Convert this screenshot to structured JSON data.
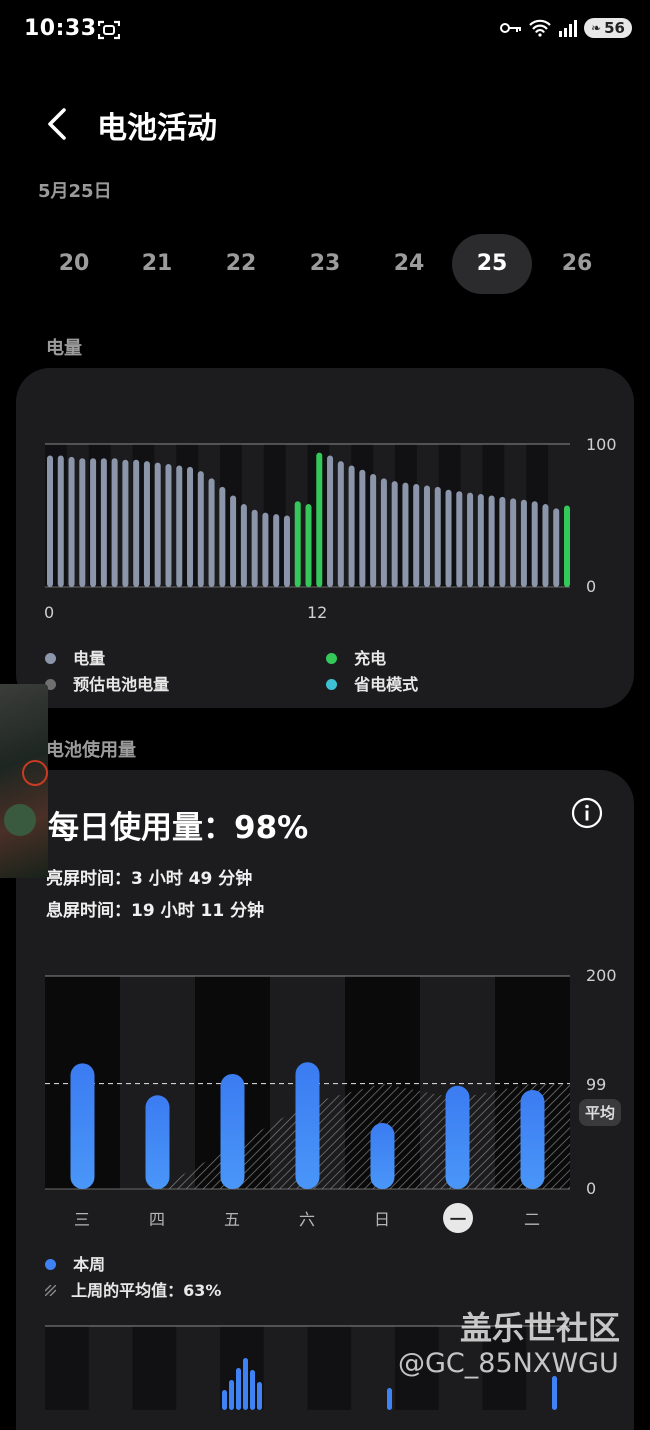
{
  "status_bar": {
    "time": "10:33",
    "battery": "56"
  },
  "header": {
    "title": "电池活动",
    "date": "5月25日"
  },
  "days": [
    "20",
    "21",
    "22",
    "23",
    "24",
    "25",
    "26"
  ],
  "battery_level": {
    "section_label": "电量",
    "y_max_label": "100",
    "y_min_label": "0",
    "x_labels": [
      "0",
      "12"
    ],
    "legend": [
      "电量",
      "充电",
      "预估电池电量",
      "省电模式"
    ],
    "colors": {
      "level": "#8c96aa",
      "charging": "#34c759",
      "estimate": "#707070",
      "saver": "#3ec0d4"
    }
  },
  "usage": {
    "section_label": "电池使用量",
    "daily_usage": "每日使用量：98%",
    "screen_on": "亮屏时间：3 小时 49 分钟",
    "screen_off": "息屏时间：19 小时 11 分钟",
    "y_max_label": "200",
    "avg_label": "99",
    "y_min_label": "0",
    "avg_badge": "平均",
    "weekdays": [
      "三",
      "四",
      "五",
      "六",
      "日",
      "一",
      "二"
    ],
    "legend_this_week": "本周",
    "legend_last_week": "上周的平均值：63%",
    "colors": {
      "bar": "#3f82f4"
    }
  },
  "watermark": {
    "site": "盖乐世社区",
    "user": "@GC_85NXWGU"
  },
  "chart_data": [
    {
      "type": "bar",
      "title": "电量",
      "x": [
        "0",
        "",
        "",
        "",
        "",
        "",
        "",
        "",
        "",
        "",
        "",
        "",
        "12",
        "",
        "",
        "",
        "",
        "",
        "",
        "",
        "",
        "",
        "",
        ""
      ],
      "series": [
        {
          "name": "电量",
          "values": [
            92,
            92,
            91,
            90,
            90,
            90,
            90,
            89,
            89,
            88,
            87,
            86,
            85,
            84,
            81,
            76,
            70,
            64,
            58,
            54,
            52,
            51,
            50,
            60,
            58,
            94,
            92,
            88,
            85,
            82,
            79,
            76,
            74,
            73,
            72,
            71,
            70,
            68,
            67,
            66,
            65,
            64,
            63,
            62,
            61,
            60,
            58,
            55,
            57
          ]
        }
      ],
      "ylim": [
        0,
        100
      ],
      "xlabel": "",
      "ylabel": ""
    },
    {
      "type": "bar",
      "title": "每日使用量：98%",
      "categories": [
        "三",
        "四",
        "五",
        "六",
        "日",
        "一",
        "二"
      ],
      "series": [
        {
          "name": "本周",
          "values": [
            118,
            88,
            108,
            119,
            62,
            97,
            93
          ]
        },
        {
          "name": "上周的平均值：63%",
          "values": [
            0,
            0,
            40,
            80,
            99,
            85,
            99
          ]
        }
      ],
      "ylim": [
        0,
        200
      ],
      "average": 99
    }
  ]
}
